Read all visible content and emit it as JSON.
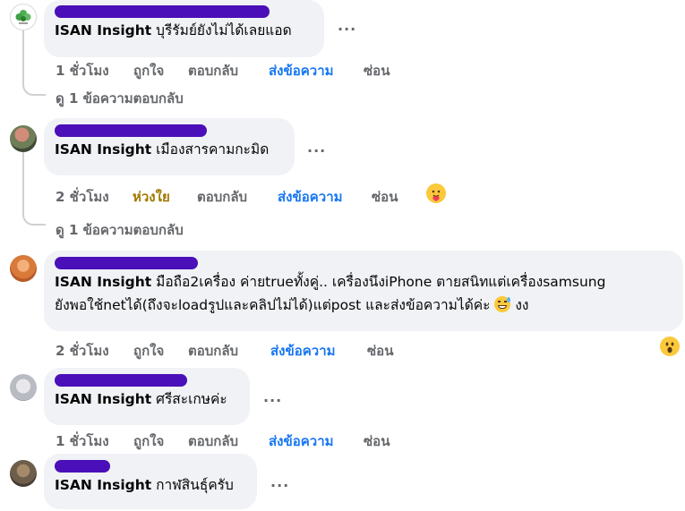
{
  "comments": [
    {
      "tag_name": "ISAN Insight",
      "text": " บุรีรัมย์ยังไม่ได้เลยแอด",
      "time": "1 ชั่วโมง",
      "like": "ถูกใจ",
      "reply": "ตอบกลับ",
      "send": "ส่งข้อความ",
      "hide": "ซ่อน",
      "view_replies": "ดู 1 ข้อความตอบกลับ"
    },
    {
      "tag_name": "ISAN Insight",
      "text": " เมืองสารคามกะมิด",
      "time": "2 ชั่วโมง",
      "like": "ห่วงใย",
      "reply": "ตอบกลับ",
      "send": "ส่งข้อความ",
      "hide": "ซ่อน",
      "view_replies": "ดู 1 ข้อความตอบกลับ",
      "reaction": "care-icon"
    },
    {
      "tag_name": "ISAN Insight",
      "text_line1": " มือถือ2เครื่อง ค่ายtrueทั้งคู่.. เครื่องนึงiPhone ตายสนิทแต่เครื่องsamsung",
      "text_line2": "ยังพอใช้netได้(ถึงจะloadรูปและคลิปไม่ได้)แต่post และส่งข้อความได้ค่ะ",
      "text_line2_tail": " งง",
      "time": "2 ชั่วโมง",
      "like": "ถูกใจ",
      "reply": "ตอบกลับ",
      "send": "ส่งข้อความ",
      "hide": "ซ่อน",
      "reaction": "wow-icon"
    },
    {
      "tag_name": "ISAN Insight",
      "text": " ศรีสะเกษค่ะ",
      "time": "1 ชั่วโมง",
      "like": "ถูกใจ",
      "reply": "ตอบกลับ",
      "send": "ส่งข้อความ",
      "hide": "ซ่อน"
    },
    {
      "tag_name": "ISAN Insight",
      "text": " กาฬสินธุ์ครับ"
    }
  ],
  "more_label": "...",
  "colors": {
    "link": "#1877f2",
    "care": "#a07900",
    "bubble": "#f0f2f5",
    "redaction": "#4a0fb8"
  }
}
